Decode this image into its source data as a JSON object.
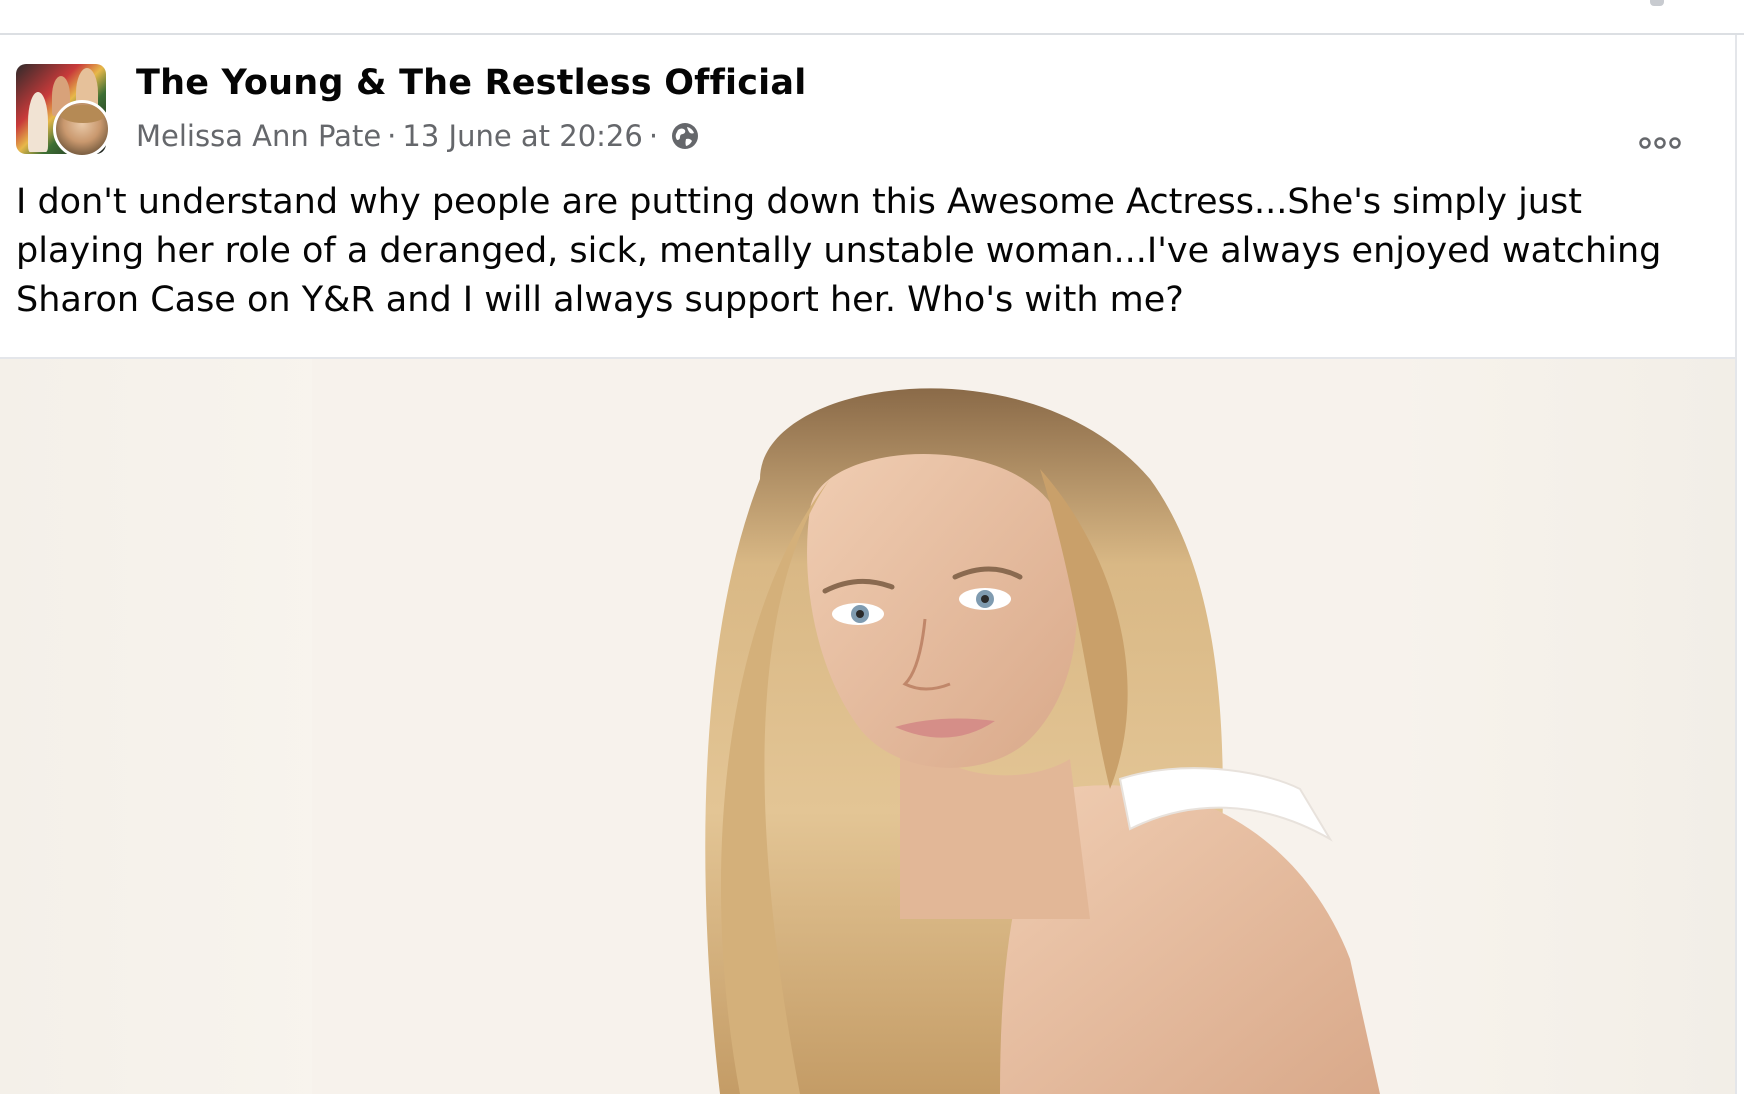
{
  "post": {
    "page_name": "The Young & The Restless Official",
    "author": "Melissa Ann Pate",
    "separator": "·",
    "timestamp": "13 June at 20:26",
    "audience_icon": "globe-icon",
    "more_icon": "more-options-icon",
    "text": "I don't understand why people are putting down this Awesome Actress...She's simply just playing her role of a deranged, sick, mentally unstable woman...I've always enjoyed watching Sharon Case on Y&R and I will always support her. Who's with me?",
    "photo_subject": "portrait"
  },
  "colors": {
    "primary_text": "#050505",
    "secondary_text": "#65676b",
    "divider": "#e4e6ea"
  }
}
